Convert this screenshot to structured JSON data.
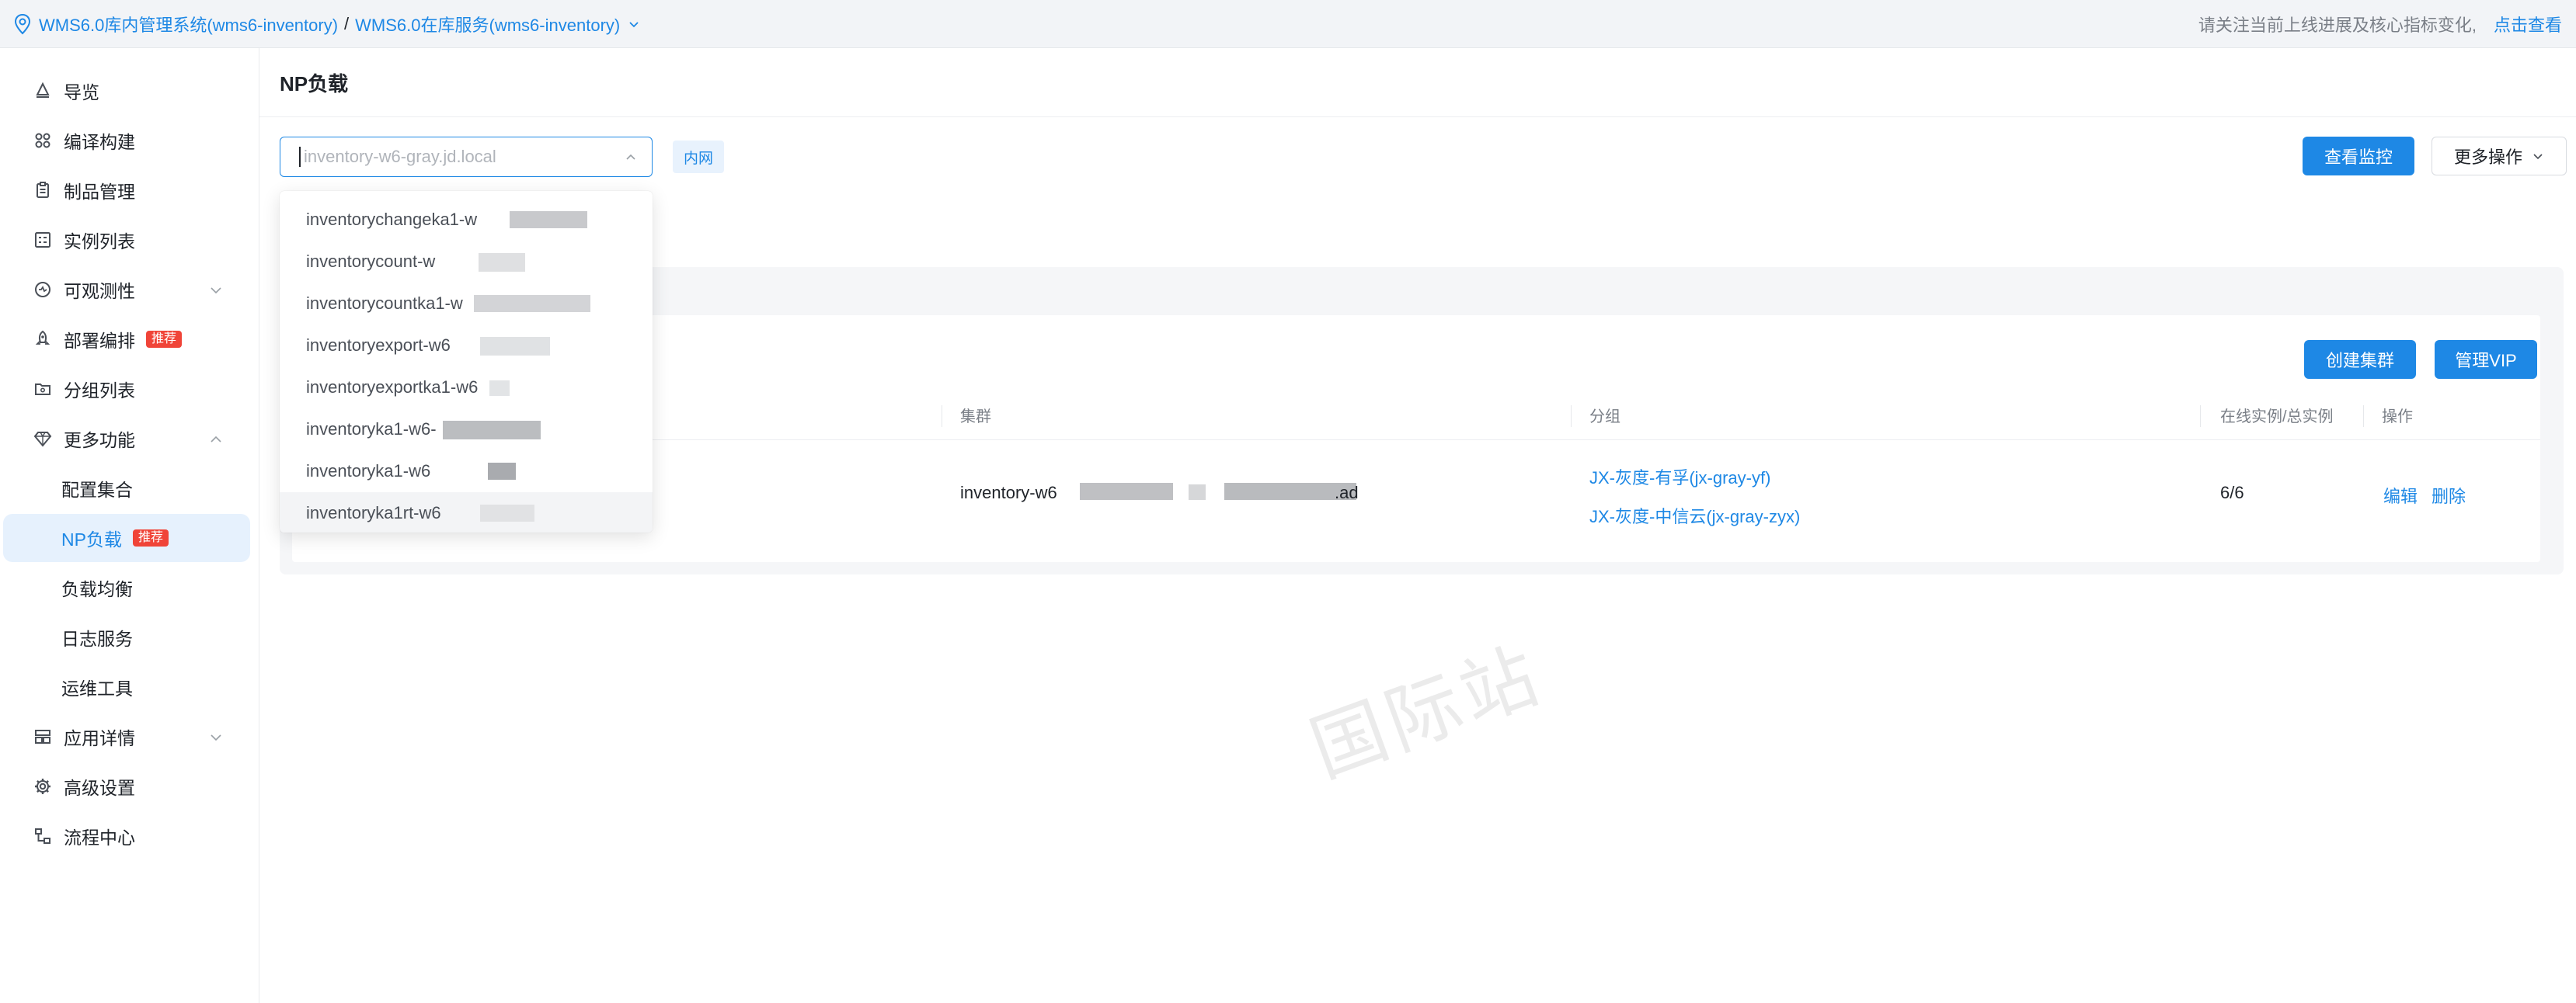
{
  "topbar": {
    "system": "WMS6.0库内管理系统(wms6-inventory)",
    "separator": "/",
    "service": "WMS6.0在库服务(wms6-inventory)",
    "notice": "请关注当前上线进展及核心指标变化,",
    "notice_link": "点击查看"
  },
  "sidebar": {
    "items": [
      {
        "label": "导览",
        "icon": "tag-icon"
      },
      {
        "label": "编译构建",
        "icon": "build-icon"
      },
      {
        "label": "制品管理",
        "icon": "clipboard-icon"
      },
      {
        "label": "实例列表",
        "icon": "grid-list-icon"
      },
      {
        "label": "可观测性",
        "icon": "monitor-icon"
      },
      {
        "label": "部署编排",
        "icon": "rocket-icon",
        "tag": "推荐"
      },
      {
        "label": "分组列表",
        "icon": "folder-icon"
      },
      {
        "label": "更多功能",
        "icon": "diamond-icon"
      },
      {
        "label": "配置集合"
      },
      {
        "label": "NP负载",
        "tag": "推荐"
      },
      {
        "label": "负载均衡"
      },
      {
        "label": "日志服务"
      },
      {
        "label": "运维工具"
      },
      {
        "label": "应用详情",
        "icon": "layout-icon"
      },
      {
        "label": "高级设置",
        "icon": "gear-icon"
      },
      {
        "label": "流程中心",
        "icon": "flow-icon"
      }
    ]
  },
  "main": {
    "title": "NP负载",
    "select_placeholder": "inventory-w6-gray.jd.local",
    "net_badge": "内网",
    "view_monitor": "查看监控",
    "more_actions": "更多操作",
    "create_cluster": "创建集群",
    "manage_vip": "管理VIP",
    "columns": [
      "集群",
      "分组",
      "在线实例/总实例",
      "操作"
    ],
    "row": {
      "cluster_prefix": "inventory-w6",
      "cluster_suffix": ".ad",
      "groups": [
        "JX-灰度-有孚(jx-gray-yf)",
        "JX-灰度-中信云(jx-gray-zyx)"
      ],
      "instances": "6/6",
      "edit": "编辑",
      "delete": "删除"
    }
  },
  "dropdown": {
    "options": [
      "inventorychangeka1-w",
      "inventorycount-w",
      "inventorycountka1-w",
      "inventoryexport-w6",
      "inventoryexportka1-w6",
      "inventoryka1-w6-",
      "inventoryka1-w6",
      "inventoryka1rt-w6"
    ]
  },
  "watermark": "国际站",
  "colors": {
    "accent": "#1e88e5",
    "tag": "#f04438"
  }
}
